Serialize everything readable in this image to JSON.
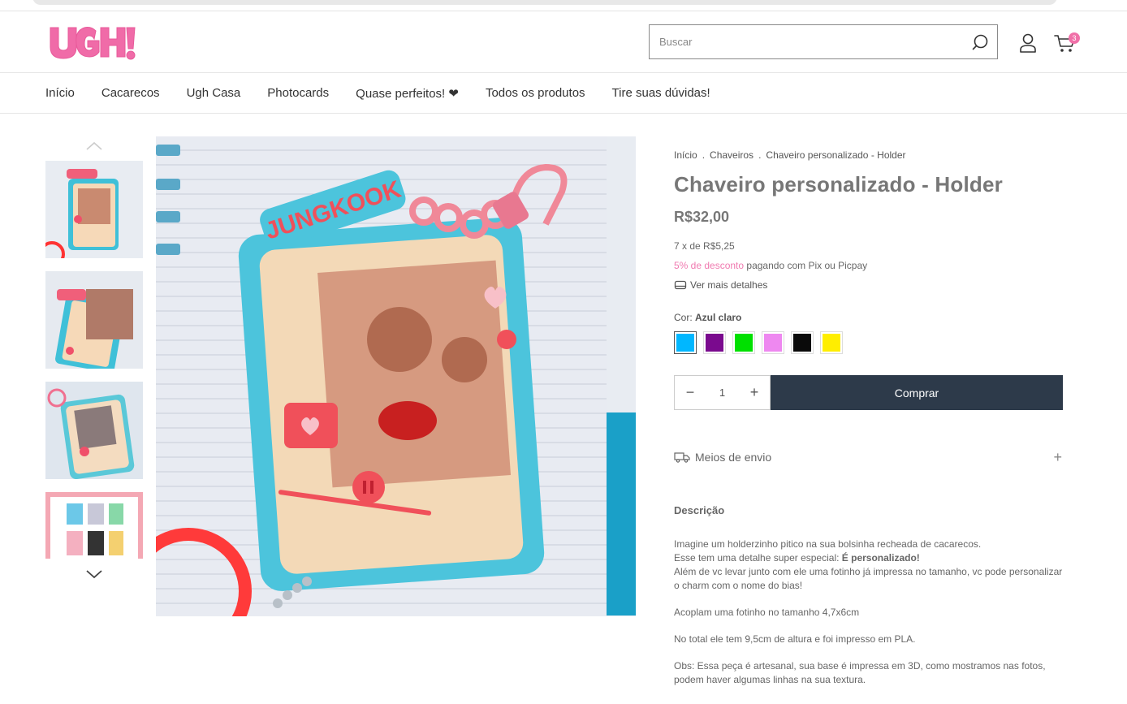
{
  "header": {
    "logo_text": "UGH!",
    "search_placeholder": "Buscar",
    "cart_count": "3"
  },
  "nav": {
    "items": [
      "Início",
      "Cacarecos",
      "Ugh Casa",
      "Photocards",
      "Quase perfeitos! ❤",
      "Todos os produtos",
      "Tire suas dúvidas!"
    ]
  },
  "product": {
    "breadcrumb": [
      "Início",
      "Chaveiros",
      "Chaveiro personalizado - Holder"
    ],
    "title": "Chaveiro personalizado - Holder",
    "price": "R$32,00",
    "installments": "7 x de R$5,25",
    "discount_highlight": "5% de desconto",
    "discount_rest": " pagando com Pix ou Picpay",
    "details_link": "Ver mais detalhes",
    "color_label": "Cor: ",
    "color_selected": "Azul claro",
    "colors": [
      "#00b7ff",
      "#7a0a8e",
      "#00e000",
      "#ee88f0",
      "#0a0a0a",
      "#ffee00"
    ],
    "quantity": "1",
    "buy_label": "Comprar",
    "shipping_label": "Meios de envio",
    "description_title": "Descrição",
    "description": {
      "p1a": "Imagine um holderzinho pitico na sua bolsinha recheada de cacarecos.",
      "p1b": "Esse tem uma detalhe super especial: ",
      "p1b_bold": "É personalizado!",
      "p1c": "Além de vc levar junto com ele uma fotinho já impressa no tamanho, vc pode personalizar o charm com o nome do bias!",
      "p2": "Acoplam uma fotinho no tamanho 4,7x6cm",
      "p3": "No total ele tem 9,5cm de altura e foi impresso em PLA.",
      "p4": "Obs: Essa peça é artesanal, sua base é impressa em 3D, como mostramos nas fotos, podem haver algumas linhas na sua textura."
    }
  },
  "images": {
    "charm_text": "JUNGKOOK"
  }
}
